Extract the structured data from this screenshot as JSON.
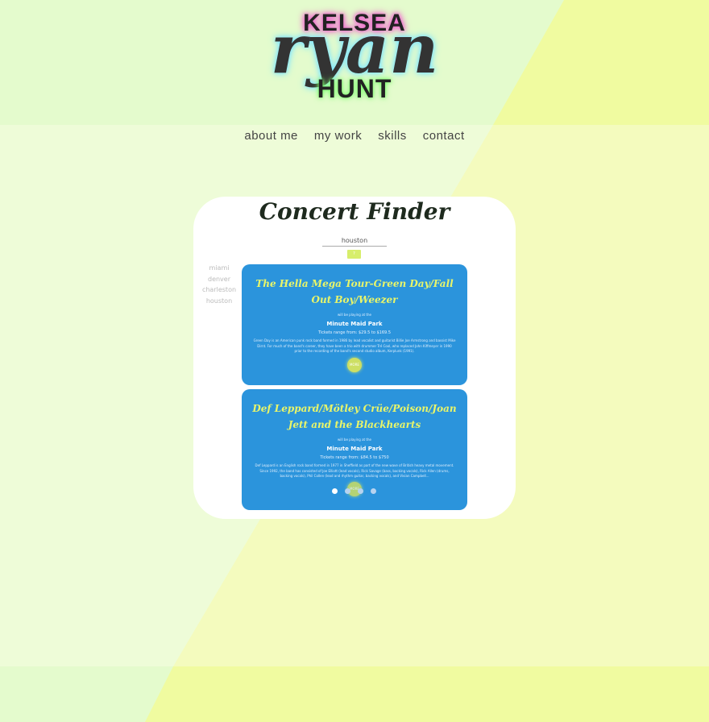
{
  "logo": {
    "first": "KELSEA",
    "middle": "ryan",
    "last": "HUNT"
  },
  "nav": {
    "items": [
      "about me",
      "my work",
      "skills",
      "contact"
    ]
  },
  "project": {
    "title": "Concert Finder",
    "search_value": "houston",
    "go_label": "?",
    "cities": [
      "miami",
      "denver",
      "charleston",
      "houston"
    ],
    "cards": [
      {
        "title": "The Hella Mega Tour-Green Day/Fall Out Boy/Weezer",
        "intro": "will be playing at the",
        "venue": "Minute Maid Park",
        "tickets": "Tickets range from: $29.5 to $169.5",
        "desc": "Green Day is an American punk rock band formed in 1986 by lead vocalist and guitarist Billie Joe Armstrong and bassist Mike Dirnt. For much of the band's career, they have been a trio with drummer Tré Cool, who replaced John Kiffmeyer in 1990 prior to the recording of the band's second studio album, Kerplunk (1991).",
        "more_label": "MORE"
      },
      {
        "title": "Def Leppard/Mötley Crüe/Poison/Joan Jett and the Blackhearts",
        "intro": "will be playing at the",
        "venue": "Minute Maid Park",
        "tickets": "Tickets range from: $84.5 to $750",
        "desc": "Def Leppard is an English rock band formed in 1977 in Sheffield as part of the new wave of British heavy metal movement. Since 1992, the band has consisted of Joe Elliott (lead vocals), Rick Savage (bass, backing vocals), Rick Allen (drums, backing vocals), Phil Collen (lead and rhythm guitar, backing vocals), and Vivian Campbell...",
        "more_label": "MORE"
      }
    ],
    "carousel": {
      "total": 4,
      "active_index": 0
    }
  },
  "colors": {
    "background": "#e4fbcd",
    "accent_yellow": "#f2fba2",
    "card_blue": "#2b94dc",
    "title_yellow": "#e8f56a"
  }
}
